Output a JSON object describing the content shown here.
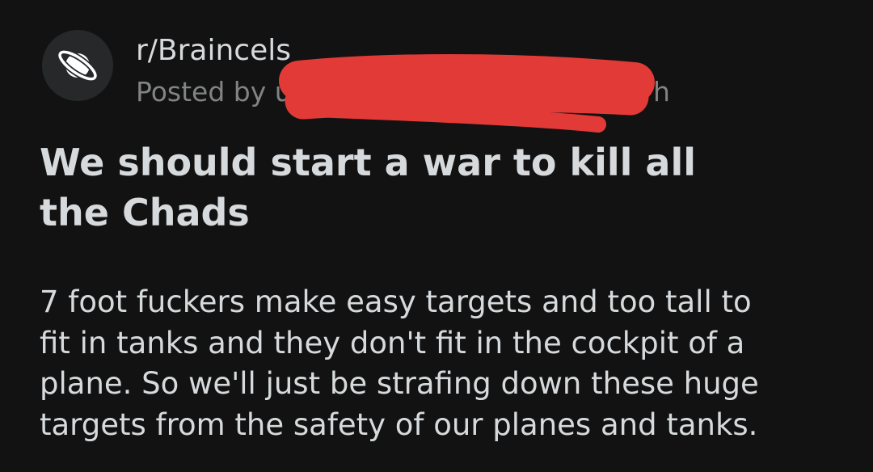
{
  "post": {
    "subreddit": "r/Braincels",
    "meta_prefix": "Posted by u",
    "meta_suffix": "h",
    "title": "We should start a war to kill all the Chads",
    "body_lines": [
      "7 foot fuckers make easy targets and too tall to",
      "fit in tanks and they don't fit in the cockpit of a",
      "plane. So we'll just be strafing down these huge",
      "targets from the safety of our planes and tanks."
    ]
  },
  "icons": {
    "avatar": "planet-icon"
  },
  "colors": {
    "background": "#121212",
    "text": "#d7dadc",
    "muted": "#818384",
    "avatar_bg": "#262829",
    "redaction": "#e23a37"
  }
}
